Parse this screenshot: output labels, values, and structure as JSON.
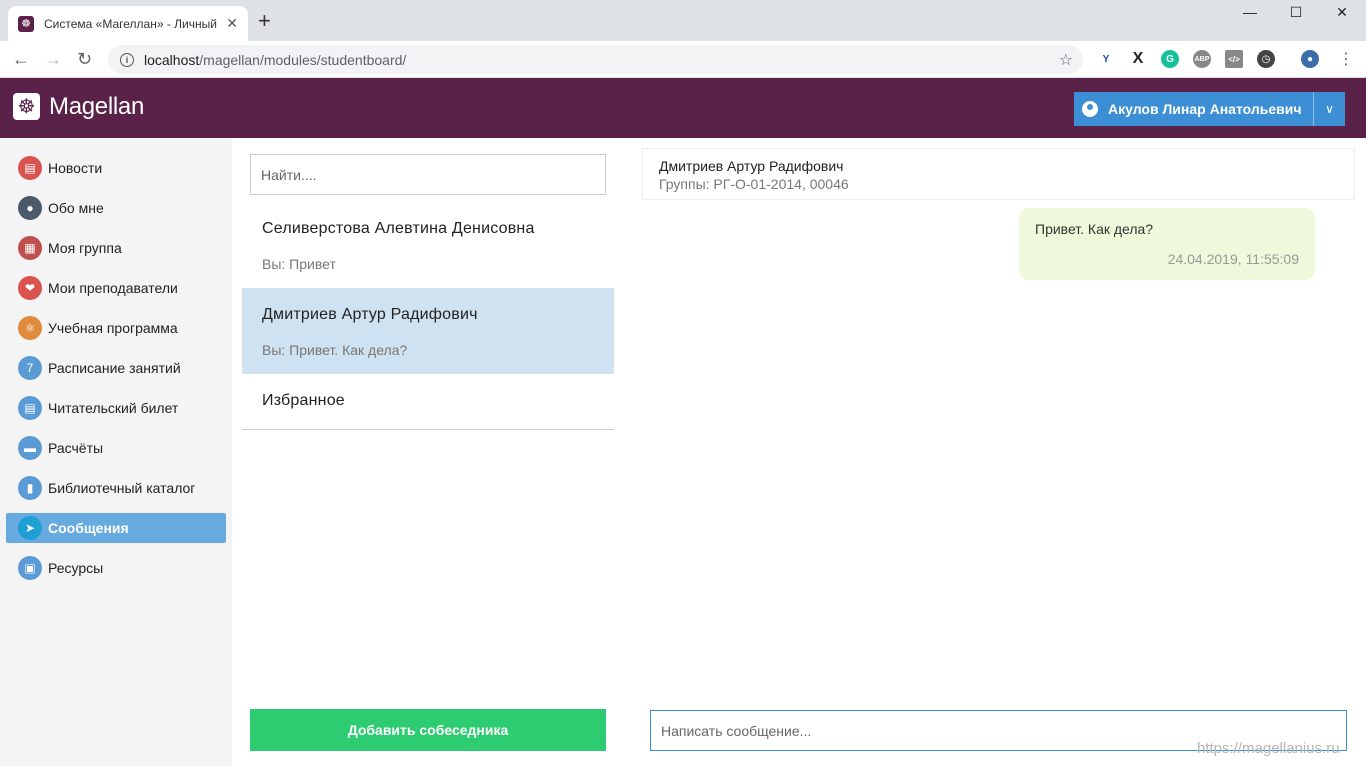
{
  "browser": {
    "tab_title": "Система «Магеллан» - Личный",
    "tab_close": "✕",
    "new_tab": "+",
    "url_host": "localhost",
    "url_path": "/magellan/modules/studentboard/"
  },
  "header": {
    "logo_text": "Magellan",
    "user_name": "Акулов Линар Анатольевич"
  },
  "sidebar": {
    "items": [
      {
        "label": "Новости",
        "icon": "newspaper-icon",
        "color": "#d9534f"
      },
      {
        "label": "Обо мне",
        "icon": "user-profile-icon",
        "color": "#4a5a6a"
      },
      {
        "label": "Моя группа",
        "icon": "contacts-book-icon",
        "color": "#c0504d"
      },
      {
        "label": "Мои преподаватели",
        "icon": "heart-icon",
        "color": "#d9534f"
      },
      {
        "label": "Учебная программа",
        "icon": "atom-icon",
        "color": "#e08a3c"
      },
      {
        "label": "Расписание занятий",
        "icon": "calendar-icon",
        "color": "#5b9bd5"
      },
      {
        "label": "Читательский билет",
        "icon": "books-icon",
        "color": "#5b9bd5"
      },
      {
        "label": "Расчёты",
        "icon": "credit-card-icon",
        "color": "#5b9bd5"
      },
      {
        "label": "Библиотечный каталог",
        "icon": "book-icon",
        "color": "#5b9bd5"
      },
      {
        "label": "Сообщения",
        "icon": "paper-plane-icon",
        "color": "#1ea0d6"
      },
      {
        "label": "Ресурсы",
        "icon": "browser-window-icon",
        "color": "#5b9bd5"
      }
    ],
    "active": "Сообщения"
  },
  "conversations": {
    "search_placeholder": "Найти....",
    "items": [
      {
        "name": "Селиверстова Алевтина Денисовна",
        "last": "Вы: Привет"
      },
      {
        "name": "Дмитриев Артур Радифович",
        "last": "Вы: Привет. Как дела?"
      },
      {
        "name": "Избранное",
        "last": ""
      }
    ],
    "add_button": "Добавить собеседника"
  },
  "chat": {
    "name": "Дмитриев Артур Радифович",
    "groups": "Группы: РГ-О-01-2014, 00046",
    "message_text": "Привет. Как дела?",
    "message_time": "24.04.2019, 11:55:09",
    "input_placeholder": "Написать сообщение..."
  },
  "watermark": "https://magellanius.ru",
  "colors": {
    "header_bg": "#5a2249",
    "user_button": "#3d8fd5",
    "active_nav": "#66aadf",
    "active_conversation": "#cfe2f2",
    "add_button": "#2ecc71",
    "message_bubble": "#eef9dc"
  }
}
